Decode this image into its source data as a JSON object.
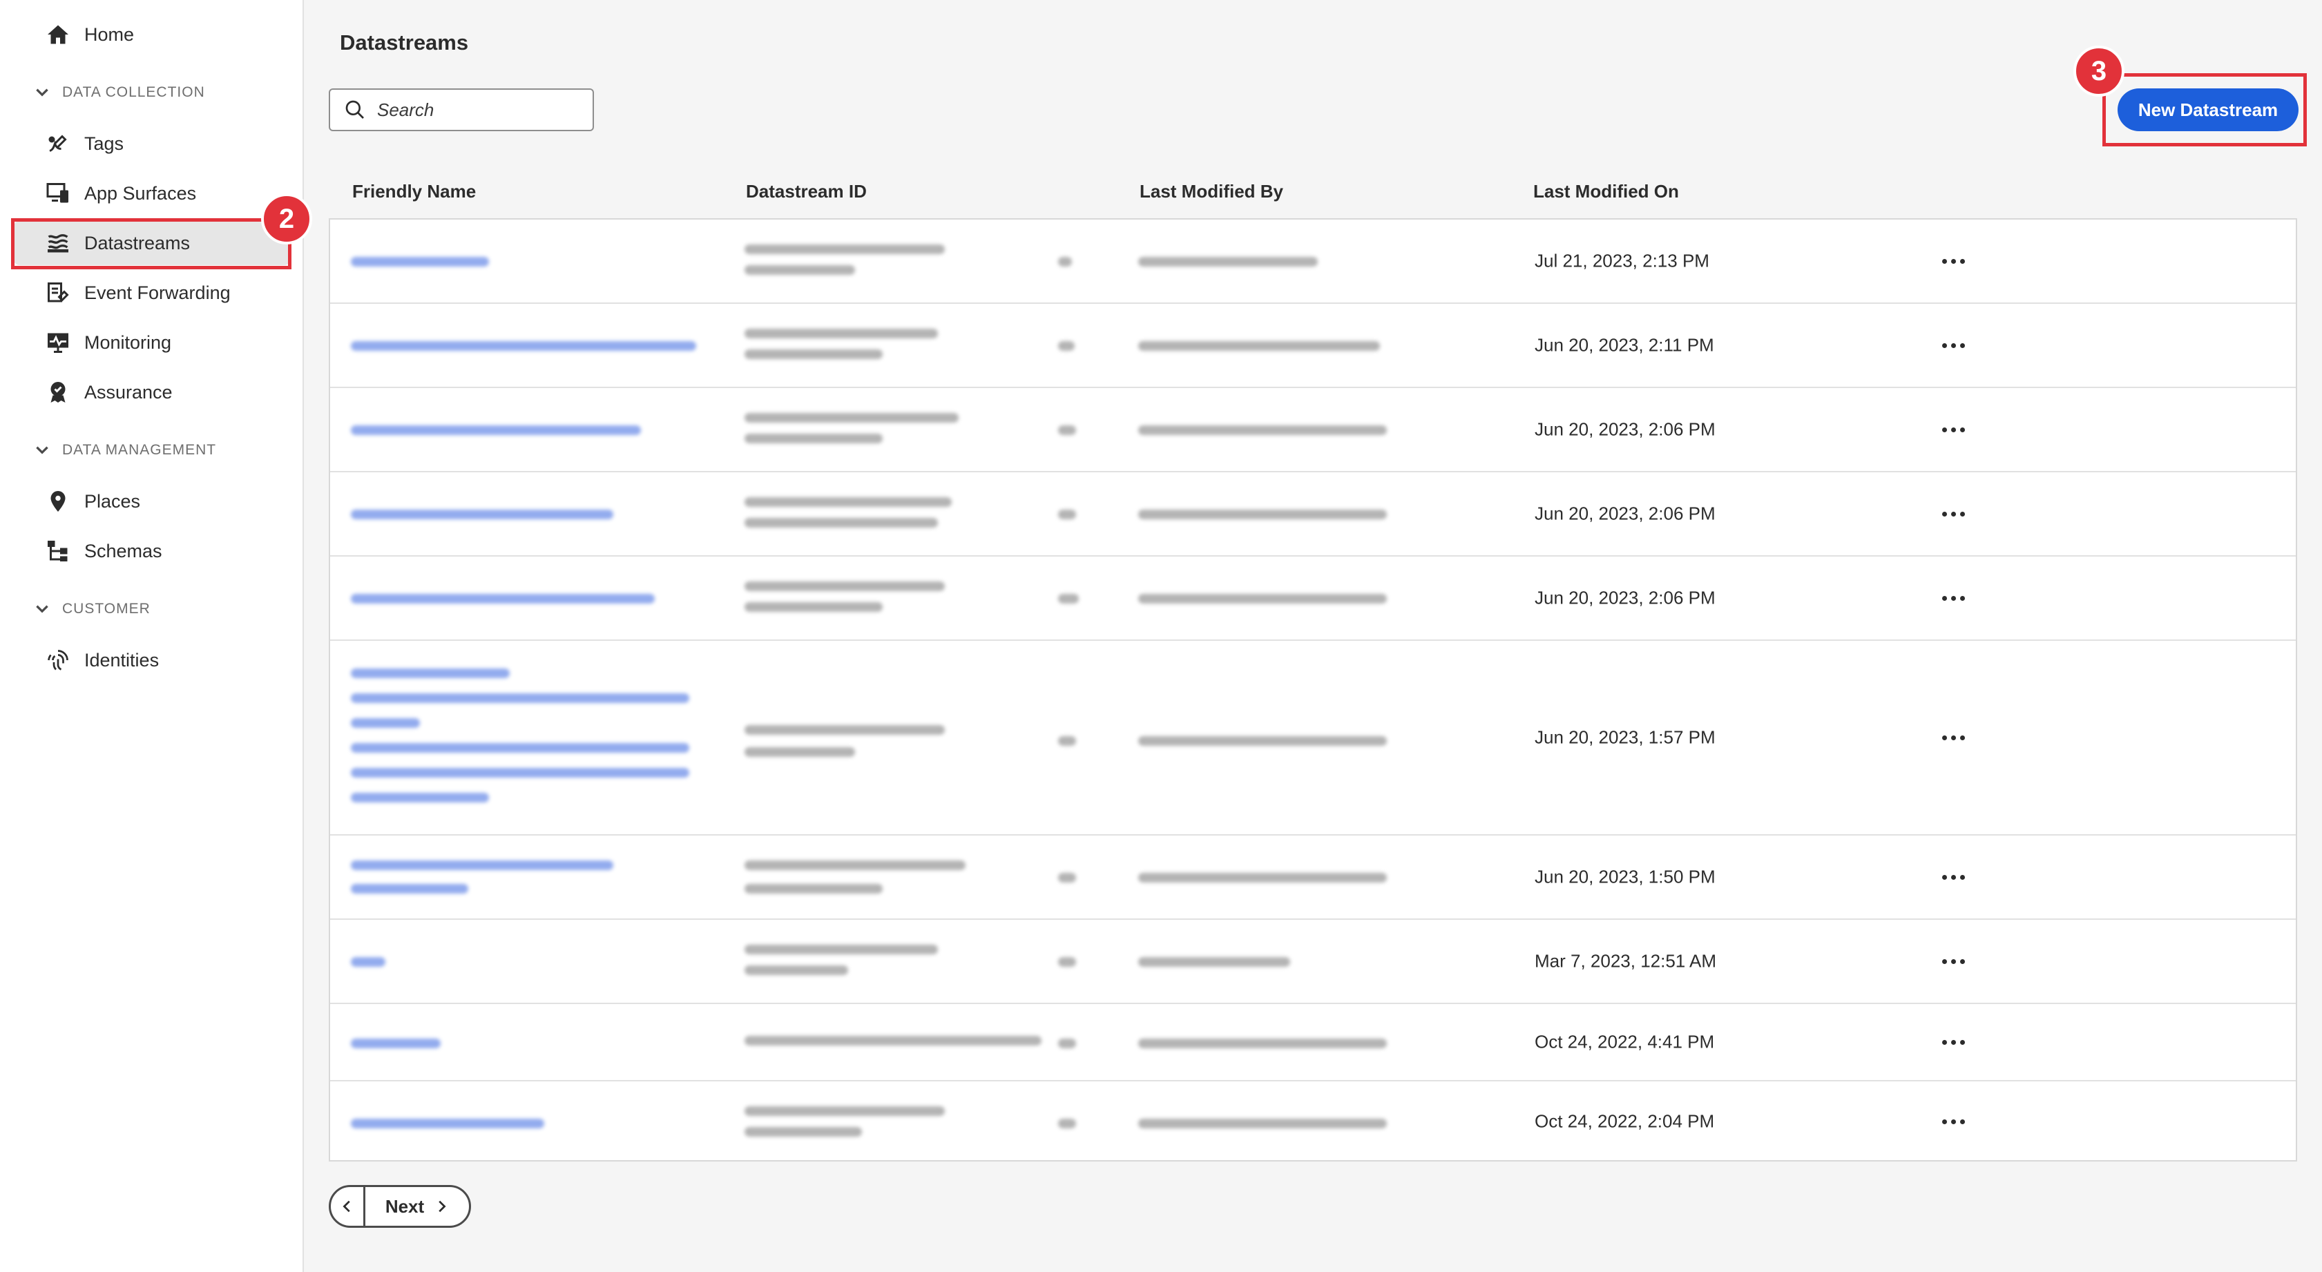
{
  "sidebar": {
    "home": "Home",
    "sections": {
      "data_collection": "DATA COLLECTION",
      "data_management": "DATA MANAGEMENT",
      "customer": "CUSTOMER"
    },
    "items": {
      "tags": "Tags",
      "app_surfaces": "App Surfaces",
      "datastreams": "Datastreams",
      "event_forwarding": "Event Forwarding",
      "monitoring": "Monitoring",
      "assurance": "Assurance",
      "places": "Places",
      "schemas": "Schemas",
      "identities": "Identities"
    }
  },
  "main": {
    "title": "Datastreams",
    "search_placeholder": "Search",
    "new_button": "New Datastream"
  },
  "table": {
    "columns": [
      "Friendly Name",
      "Datastream ID",
      "Last Modified By",
      "Last Modified On"
    ],
    "rows": [
      {
        "modified_on": "Jul 21, 2023, 2:13 PM"
      },
      {
        "modified_on": "Jun 20, 2023, 2:11 PM"
      },
      {
        "modified_on": "Jun 20, 2023, 2:06 PM"
      },
      {
        "modified_on": "Jun 20, 2023, 2:06 PM"
      },
      {
        "modified_on": "Jun 20, 2023, 2:06 PM"
      },
      {
        "modified_on": "Jun 20, 2023, 1:57 PM"
      },
      {
        "modified_on": "Jun 20, 2023, 1:50 PM"
      },
      {
        "modified_on": "Mar 7, 2023, 12:51 AM"
      },
      {
        "modified_on": "Oct 24, 2022, 4:41 PM"
      },
      {
        "modified_on": "Oct 24, 2022, 2:04 PM"
      }
    ]
  },
  "pagination": {
    "next": "Next"
  },
  "callouts": {
    "two": "2",
    "three": "3"
  },
  "colors": {
    "accent": "#1d5fdb",
    "callout": "#e2323a"
  }
}
